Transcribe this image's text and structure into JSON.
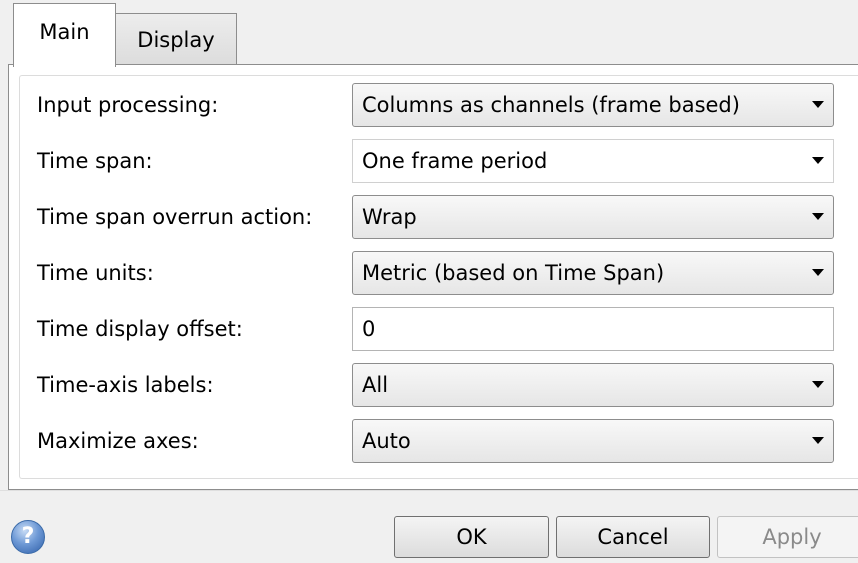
{
  "tabs": [
    {
      "label": "Main",
      "active": true
    },
    {
      "label": "Display",
      "active": false
    }
  ],
  "form": {
    "rows": [
      {
        "label": "Input processing:",
        "value": "Columns as channels (frame based)",
        "control": "dropdown"
      },
      {
        "label": "Time span:",
        "value": "One frame period",
        "control": "dropdown"
      },
      {
        "label": "Time span overrun action:",
        "value": "Wrap",
        "control": "dropdown"
      },
      {
        "label": "Time units:",
        "value": "Metric (based on Time Span)",
        "control": "dropdown"
      },
      {
        "label": "Time display offset:",
        "value": "0",
        "control": "text"
      },
      {
        "label": "Time-axis labels:",
        "value": "All",
        "control": "dropdown"
      },
      {
        "label": "Maximize axes:",
        "value": "Auto",
        "control": "dropdown"
      }
    ]
  },
  "footer": {
    "help_icon": "question-mark-icon",
    "ok_label": "OK",
    "cancel_label": "Cancel",
    "apply_label": "Apply",
    "apply_enabled": false
  }
}
